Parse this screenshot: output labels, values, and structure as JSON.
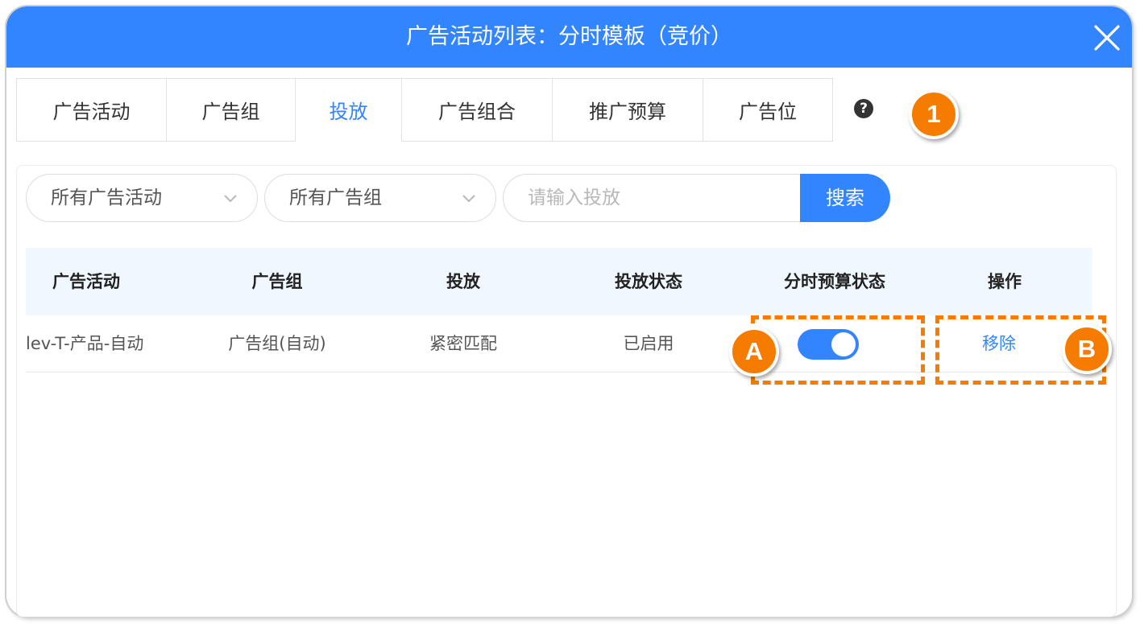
{
  "dialog": {
    "title": "广告活动列表：分时模板（竞价）"
  },
  "tabs": [
    {
      "label": "广告活动",
      "active": false
    },
    {
      "label": "广告组",
      "active": false
    },
    {
      "label": "投放",
      "active": true
    },
    {
      "label": "广告组合",
      "active": false
    },
    {
      "label": "推广预算",
      "active": false
    },
    {
      "label": "广告位",
      "active": false
    }
  ],
  "help": {
    "icon": "question-circle-icon",
    "glyph": "?"
  },
  "filters": {
    "campaign_select": "所有广告活动",
    "adgroup_select": "所有广告组",
    "search_placeholder": "请输入投放",
    "search_button": "搜索"
  },
  "table": {
    "headers": [
      "广告活动",
      "广告组",
      "投放",
      "投放状态",
      "分时预算状态",
      "操作"
    ],
    "rows": [
      {
        "campaign": "lev-T-产品-自动",
        "adgroup": "广告组(自动)",
        "targeting": "紧密匹配",
        "status": "已启用",
        "budget_status_on": true,
        "action": "移除"
      }
    ]
  },
  "callouts": {
    "marker_1": "1",
    "marker_a": "A",
    "marker_b": "B"
  },
  "colors": {
    "accent": "#3385ff",
    "callout": "#f57c00",
    "header_bg": "#f0f7fe"
  }
}
